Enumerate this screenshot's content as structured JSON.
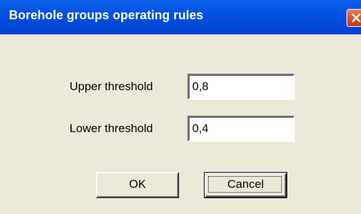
{
  "window": {
    "title": "Borehole groups operating rules",
    "close_icon": "close-x-icon",
    "colors": {
      "titlebar": "#0454e3",
      "close_button": "#d9542c",
      "dialog_background": "#ece9d8"
    }
  },
  "form": {
    "upper_threshold": {
      "label": "Upper threshold",
      "value": "0,8"
    },
    "lower_threshold": {
      "label": "Lower threshold",
      "value": "0,4"
    }
  },
  "buttons": {
    "ok_label": "OK",
    "cancel_label": "Cancel"
  }
}
